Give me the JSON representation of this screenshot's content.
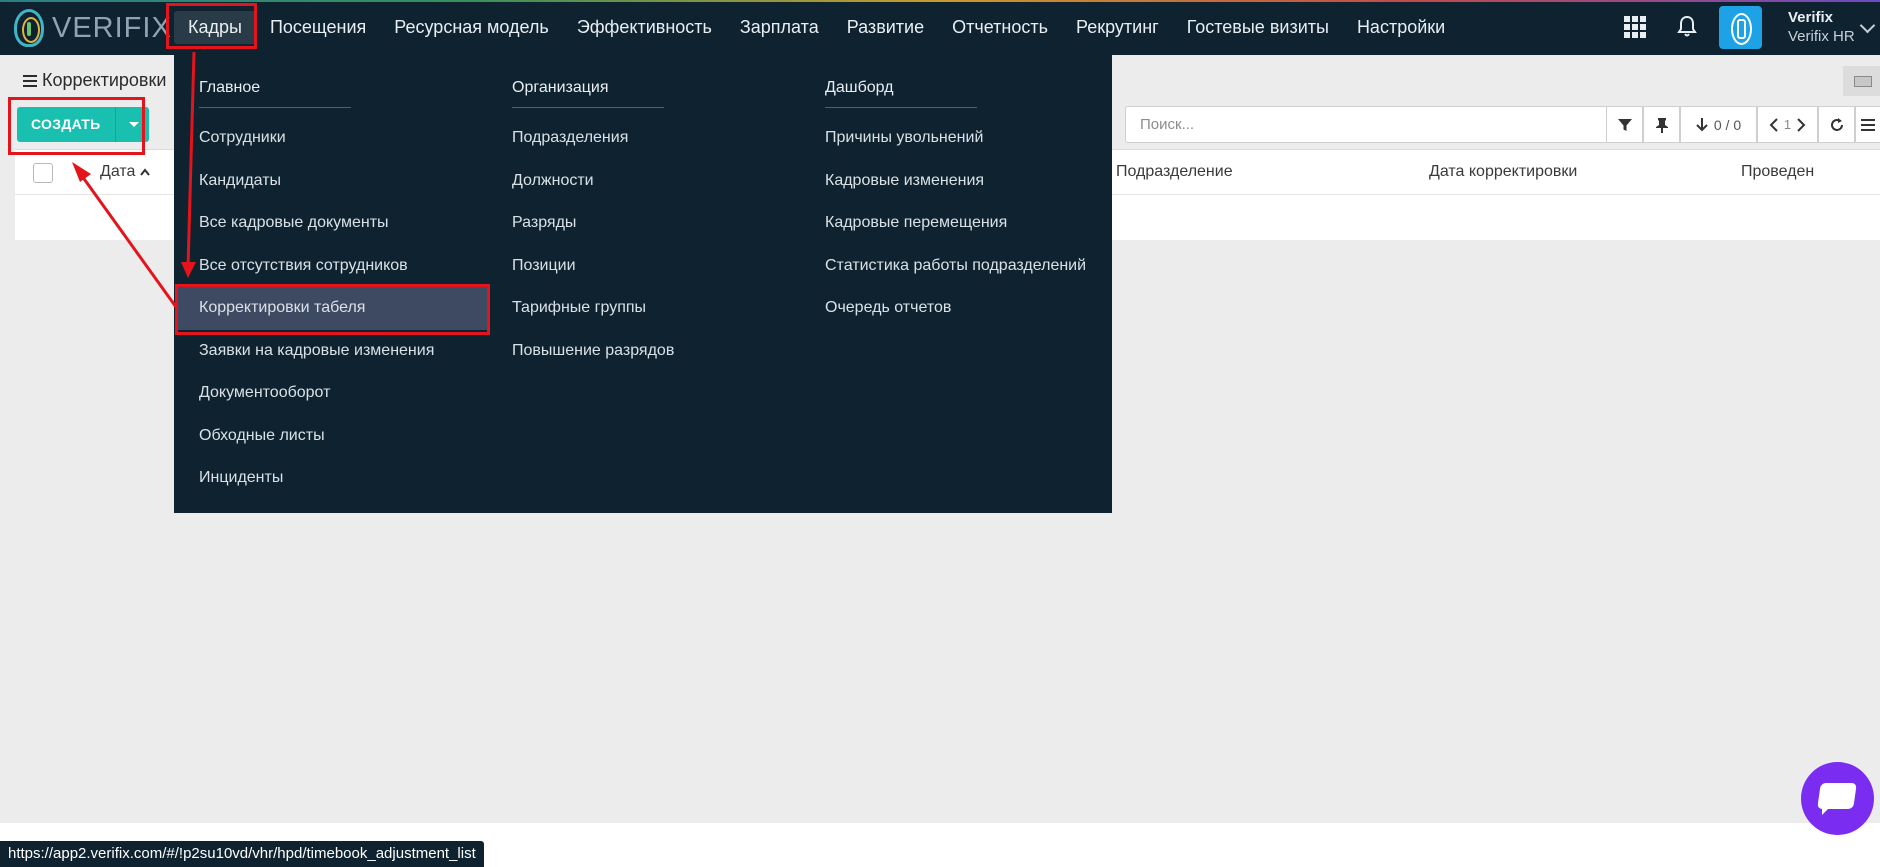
{
  "app": {
    "logo_text": "VERIFIX",
    "user_name": "Verifix",
    "user_org": "Verifix HR"
  },
  "nav": {
    "items": [
      "Кадры",
      "Посещения",
      "Ресурсная модель",
      "Эффективность",
      "Зарплата",
      "Развитие",
      "Отчетность",
      "Рекрутинг",
      "Гостевые визиты",
      "Настройки"
    ],
    "active": "Кадры"
  },
  "page": {
    "title": "Корректировки"
  },
  "toolbar": {
    "create_label": "СОЗДАТЬ",
    "search_placeholder": "Поиск...",
    "count": "0 / 0",
    "page": "1"
  },
  "table": {
    "columns": [
      "Дата",
      "Подразделение",
      "Дата корректировки",
      "Проведен"
    ]
  },
  "mega_menu": {
    "columns": [
      {
        "heading": "Главное",
        "items": [
          "Сотрудники",
          "Кандидаты",
          "Все кадровые документы",
          "Все отсутствия сотрудников",
          "Корректировки табеля",
          "Заявки на кадровые изменения",
          "Документооборот",
          "Обходные листы",
          "Инциденты"
        ]
      },
      {
        "heading": "Организация",
        "items": [
          "Подразделения",
          "Должности",
          "Разряды",
          "Позиции",
          "Тарифные группы",
          "Повышение разрядов"
        ]
      },
      {
        "heading": "Дашборд",
        "items": [
          "Причины увольнений",
          "Кадровые изменения",
          "Кадровые перемещения",
          "Статистика работы подразделений",
          "Очередь отчетов"
        ]
      }
    ],
    "highlighted": "Корректировки табеля"
  },
  "status_bar": {
    "url": "https://app2.verifix.com/#/!p2su10vd/vhr/hpd/timebook_adjustment_list"
  },
  "colors": {
    "nav_bg": "#0e2230",
    "accent": "#19c0b0",
    "annotation": "#e3141b",
    "chat": "#7a2cf0"
  },
  "icons": [
    "apps-grid-icon",
    "bell-icon",
    "fingerprint-avatar-icon",
    "filter-icon",
    "pin-icon",
    "sort-down-icon",
    "chevron-left-icon",
    "chevron-right-icon",
    "refresh-icon",
    "list-view-icon",
    "chat-icon"
  ]
}
